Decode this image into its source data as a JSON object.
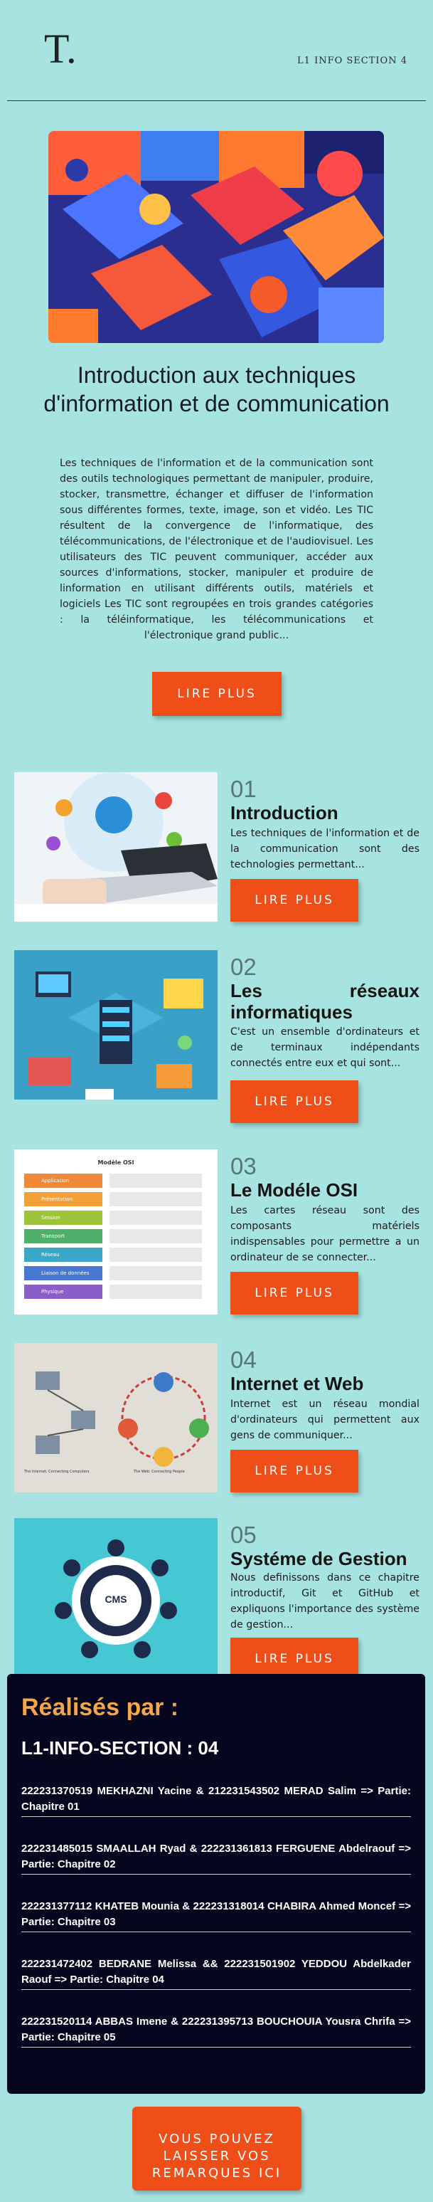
{
  "header": {
    "logo_text": "T.",
    "section_label": "L1 INFO SECTION 4"
  },
  "hero": {
    "image_icon": "abstract-3d-shapes-image",
    "title": "Introduction aux techniques d'information et de communication",
    "text": "Les techniques de l'information et de la communication sont des outils technologiques permettant de manipuler, produire, stocker, transmettre, échanger et diffuser de l'information sous différentes formes, texte, image, son et vidéo. Les TIC résultent de la convergence de l'informatique, des télécommunications, de l'électronique et de l'audiovisuel. Les utilisateurs des TIC peuvent communiquer, accéder aux sources d'informations, stocker, manipuler et produire de linformation en utilisant différents outils, matériels et logiciels Les TIC sont regroupées en trois grandes catégories : la téléinformatique, les télécommunications et l'électronique grand public...",
    "button_label": "LIRE PLUS"
  },
  "chapters": [
    {
      "number": "01",
      "title": "Introduction",
      "text": "Les techniques de l'information et de la communication sont des technologies permettant...",
      "button_label": "LIRE PLUS",
      "image_icon": "laptop-network-icons-image"
    },
    {
      "number": "02",
      "title": "Les réseaux informatiques",
      "text": "C'est un ensemble d'ordinateurs et de terminaux indépendants connectés entre eux et qui sont...",
      "button_label": "LIRE PLUS",
      "image_icon": "network-devices-isometric-image"
    },
    {
      "number": "03",
      "title": "Le Modéle OSI",
      "text": "Les cartes réseau sont des composants matériels indispensables pour permettre a un ordinateur de se connecter...",
      "button_label": "LIRE PLUS",
      "image_icon": "osi-model-diagram-image",
      "image_heading": "Modèle OSI",
      "osi_layers": [
        "Application",
        "Présentation",
        "Session",
        "Transport",
        "Réseau",
        "Liaison de données",
        "Physique"
      ]
    },
    {
      "number": "04",
      "title": "Internet et Web",
      "text": "Internet est un réseau mondial d'ordinateurs qui permettent aux gens de communiquer...",
      "button_label": "LIRE PLUS",
      "image_icon": "internet-web-diagram-image",
      "image_caption_left": "The Internet: Connecting Computers",
      "image_caption_right": "The Web: Connecting People"
    },
    {
      "number": "05",
      "title": "Systéme de Gestion",
      "text": "Nous definissons dans ce chapitre introductif, Git et GitHub et expliquons l'importance des système de gestion...",
      "button_label": "LIRE PLUS",
      "image_icon": "cms-cycle-image",
      "image_label": "CMS"
    }
  ],
  "credits": {
    "title": "Réalisés par :",
    "subtitle": "L1-INFO-SECTION : 04",
    "items": [
      "222231370519 MEKHAZNI Yacine & 212231543502 MERAD Salim => Partie: Chapitre 01",
      "222231485015 SMAALLAH Ryad & 222231361813 FERGUENE Abdelraouf => Partie: Chapitre 02",
      "222231377112 KHATEB Mounia & 222231318014 CHABIRA Ahmed Moncef => Partie: Chapitre 03",
      "222231472402 BEDRANE Melissa && 222231501902 YEDDOU Abdelkader Raouf => Partie: Chapitre 04",
      "222231520114 ABBAS Imene & 222231395713 BOUCHOUIA Yousra Chrifa => Partie: Chapitre 05"
    ]
  },
  "contact": {
    "button_label": "VOUS POUVEZ LAISSER VOS REMARQUES ICI"
  },
  "colors": {
    "background": "#a7e4e1",
    "accent": "#f04e18",
    "credits_bg": "#06061e",
    "credits_title": "#f4a64a"
  }
}
